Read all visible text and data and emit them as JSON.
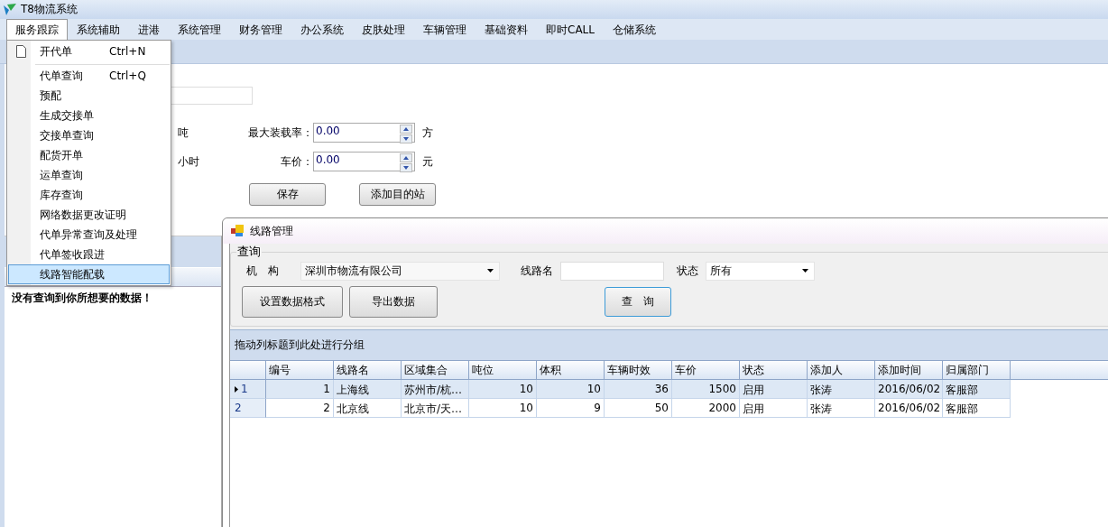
{
  "window": {
    "title": "T8物流系统"
  },
  "menu_bar": [
    {
      "label": "服务跟踪",
      "selected": true
    },
    {
      "label": "系统辅助",
      "selected": false
    },
    {
      "label": "进港",
      "selected": false
    },
    {
      "label": "系统管理",
      "selected": false
    },
    {
      "label": "财务管理",
      "selected": false
    },
    {
      "label": "办公系统",
      "selected": false
    },
    {
      "label": "皮肤处理",
      "selected": false
    },
    {
      "label": "车辆管理",
      "selected": false
    },
    {
      "label": "基础资料",
      "selected": false
    },
    {
      "label": "即时CALL",
      "selected": false
    },
    {
      "label": "仓储系统",
      "selected": false
    }
  ],
  "dropdown_menu": [
    {
      "kind": "icon_item",
      "label": "开代单",
      "shortcut": "Ctrl+N",
      "selected": false
    },
    {
      "kind": "separator"
    },
    {
      "kind": "item",
      "label": "代单查询",
      "shortcut": "Ctrl+Q",
      "selected": false
    },
    {
      "kind": "item",
      "label": "预配",
      "selected": false
    },
    {
      "kind": "item",
      "label": "生成交接单",
      "selected": false
    },
    {
      "kind": "item",
      "label": "交接单查询",
      "selected": false
    },
    {
      "kind": "item",
      "label": "配货开单",
      "selected": false
    },
    {
      "kind": "item",
      "label": "运单查询",
      "selected": false
    },
    {
      "kind": "item",
      "label": "库存查询",
      "selected": false
    },
    {
      "kind": "item",
      "label": "网络数据更改证明",
      "selected": false
    },
    {
      "kind": "item",
      "label": "代单异常查询及处理",
      "selected": false
    },
    {
      "kind": "item",
      "label": "代单签收跟进",
      "selected": false
    },
    {
      "kind": "item",
      "label": "线路智能配载",
      "selected": true
    }
  ],
  "form": {
    "weight_unit": "吨",
    "hours_unit": "小时",
    "max_load_label": "最大装载率：",
    "max_load_value": "0.00",
    "max_load_unit": "方",
    "price_label": "车价：",
    "price_value": "0.00",
    "price_unit": "元",
    "buttons": [
      "保存",
      "添加目的站"
    ]
  },
  "left_panel": {
    "message": "没有查询到你所想要的数据！"
  },
  "child_window": {
    "title": "线路管理",
    "query_group": {
      "title": "查询",
      "org_label": "机　构",
      "org_value": "深圳市物流有限公司",
      "route_label": "线路名",
      "status_label": "状态",
      "status_value": "所有",
      "buttons": [
        "设置数据格式",
        "导出数据"
      ],
      "query_button": "查　询"
    },
    "grid": {
      "group_hint": "拖动列标题到此处进行分组",
      "columns": [
        {
          "label": "编号",
          "kind": "number"
        },
        {
          "label": "线路名",
          "kind": "text"
        },
        {
          "label": "区域集合",
          "kind": "text"
        },
        {
          "label": "吨位",
          "kind": "number"
        },
        {
          "label": "体积",
          "kind": "number"
        },
        {
          "label": "车辆时效",
          "kind": "number"
        },
        {
          "label": "车价",
          "kind": "number"
        },
        {
          "label": "状态",
          "kind": "text"
        },
        {
          "label": "添加人",
          "kind": "text"
        },
        {
          "label": "添加时间",
          "kind": "text"
        },
        {
          "label": "归属部门",
          "kind": "text"
        }
      ],
      "rows": [
        {
          "row_header": "1",
          "selected": true,
          "cells": [
            "1",
            "上海线",
            "苏州市/杭…",
            "10",
            "10",
            "36",
            "1500",
            "启用",
            "张涛",
            "2016/06/02",
            "客服部"
          ]
        },
        {
          "row_header": "2",
          "selected": false,
          "cells": [
            "2",
            "北京线",
            "北京市/天…",
            "10",
            "9",
            "50",
            "2000",
            "启用",
            "张涛",
            "2016/06/02",
            "客服部"
          ]
        }
      ]
    }
  }
}
